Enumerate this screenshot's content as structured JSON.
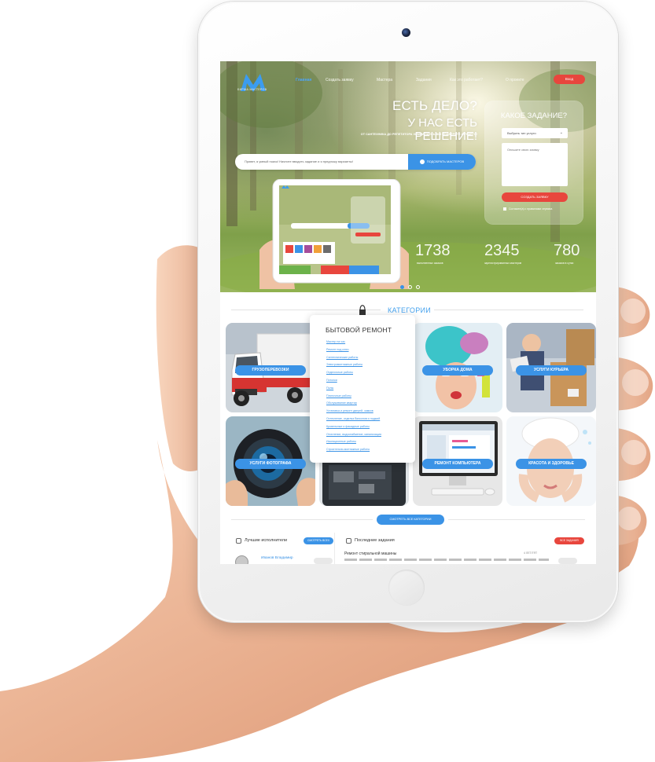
{
  "site": {
    "logo_text": "БИРЖА МАСТЕРОВ"
  },
  "nav": {
    "items": [
      "Главная",
      "Создать заявку",
      "Мастера",
      "Задания",
      "Как это работает?",
      "О проекте"
    ],
    "login": "Вход"
  },
  "hero": {
    "title_line1": "ЕСТЬ ДЕЛО?",
    "title_line2": "У НАС ЕСТЬ РЕШЕНИЕ!",
    "subtitle": "ОТ САНТЕХНИКА ДО РЕПЕТИТОРА ХИМИИ ЗДЕСЬ ВЫ ПОДБЕРЕТЕ ЛУЧШЕГО!",
    "search_placeholder": "Привет, я умный поиск! Начните вводить задание и я предложу варианты!",
    "search_button": "ПОДОБРАТЬ МАСТЕРОВ"
  },
  "task_form": {
    "title": "КАКОЕ ЗАДАНИЕ?",
    "select_value": "Выбрать тип услуги",
    "textarea_placeholder": "Опишите свою заявку",
    "submit": "СОЗДАТЬ ЗАЯВКУ",
    "agree_text": "Согласен(а) с правилами сервиса"
  },
  "stats": [
    {
      "value": "1738",
      "caption": "выполненных заказов"
    },
    {
      "value": "2345",
      "caption": "зарегистрированных мастеров"
    },
    {
      "value": "780",
      "caption": "заказов в сутки"
    }
  ],
  "categories": {
    "title": "КАТЕГОРИИ",
    "tiles": [
      {
        "label": "ГРУЗОПЕРЕВОЗКИ",
        "scene": "truck"
      },
      {
        "label": "",
        "scene": "repair"
      },
      {
        "label": "УБОРКА ДОМА",
        "scene": "cleaning"
      },
      {
        "label": "УСЛУГИ КУРЬЕРА",
        "scene": "courier"
      },
      {
        "label": "УСЛУГИ ФОТОГРАФА",
        "scene": "camera"
      },
      {
        "label": "",
        "scene": "phone"
      },
      {
        "label": "РЕМОНТ КОМПЬЮТЕРА",
        "scene": "computer"
      },
      {
        "label": "КРАСОТА И ЗДОРОВЬЕ",
        "scene": "beauty"
      }
    ],
    "popup": {
      "title": "БЫТОВОЙ РЕМОНТ",
      "items": [
        "Мастер на час",
        "Ремонт под ключ",
        "Сантехнические работы",
        "Электромонтажные работы",
        "Отделочные работы",
        "Потолки",
        "Полы",
        "Плиточные работы",
        "Обслуживание квартир",
        "Установка и ремонт дверей, замков",
        "Остекление, отделка балконов и лоджий",
        "Кровельные и фасадные работы",
        "Отопление, водоснабжение, канализация",
        "Изоляционные работы",
        "Строительно-монтажные работы"
      ]
    },
    "all_button": "СМОТРЕТЬ ВСЕ КАТЕГОРИИ"
  },
  "bottom": {
    "best_title": "Лучшие исполнители",
    "best_button": "СМОТРЕТЬ ВСЕХ",
    "executor_name": "Иванов Владимир",
    "latest_title": "Последние задания",
    "latest_button": "ВСЕ ЗАДАНИЯ",
    "job_title": "Ремонт стиральной машины",
    "job_date": "4 ЛЕТ/ГЯТ"
  },
  "colors": {
    "accent_blue": "#3b93e6",
    "accent_red": "#e8463d",
    "heading_blue": "#45a2ee"
  }
}
